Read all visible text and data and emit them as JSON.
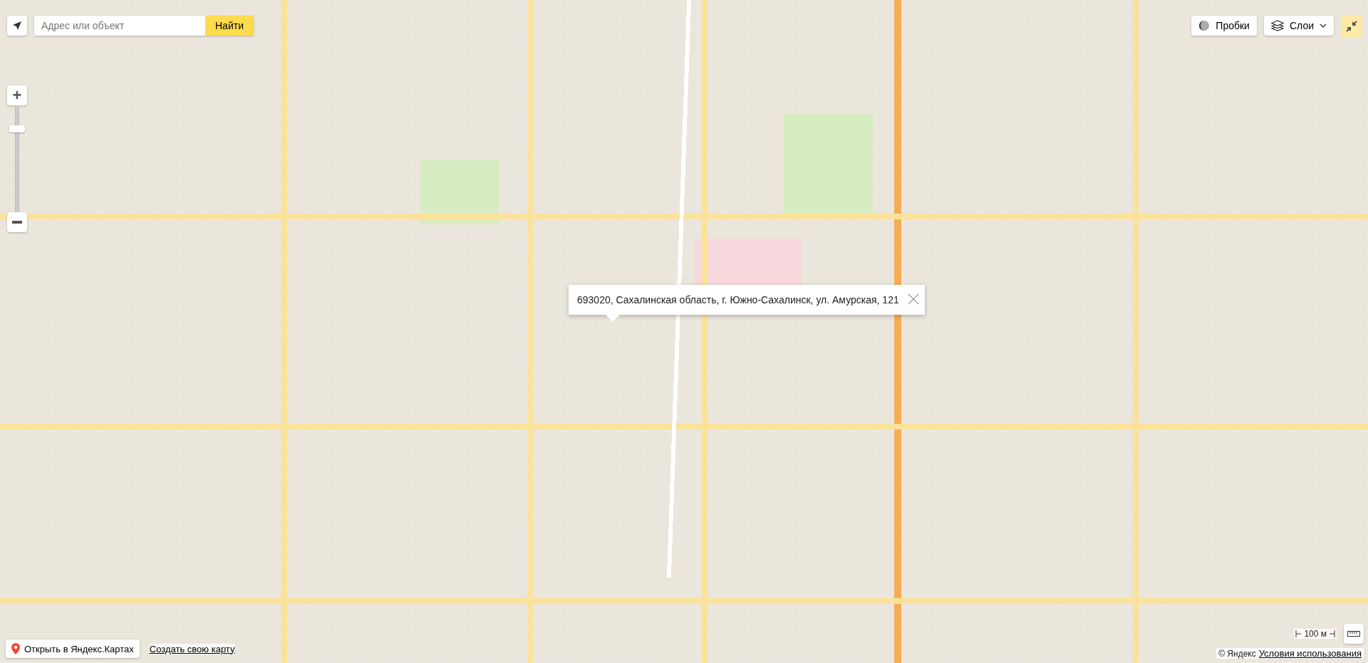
{
  "search": {
    "placeholder": "Адрес или объект",
    "button": "Найти"
  },
  "top_controls": [
    {
      "kind": "traffic",
      "label": "Пробки"
    },
    {
      "kind": "layers",
      "label": "Слои"
    },
    {
      "kind": "collapse"
    }
  ],
  "zoom": {
    "plus": "+",
    "level": 0.8
  },
  "popup": {
    "text": "693020, Сахалинская область, г. Южно-Сахалинск, ул. Амурская, 121"
  },
  "bottom_left": {
    "open_button": "Открыть в Яндекс.Картах",
    "create_link": "Создать свою карту"
  },
  "scale": {
    "label": "100 м"
  },
  "copyright": {
    "text": "© Яндекс",
    "link": "Условия использования"
  }
}
